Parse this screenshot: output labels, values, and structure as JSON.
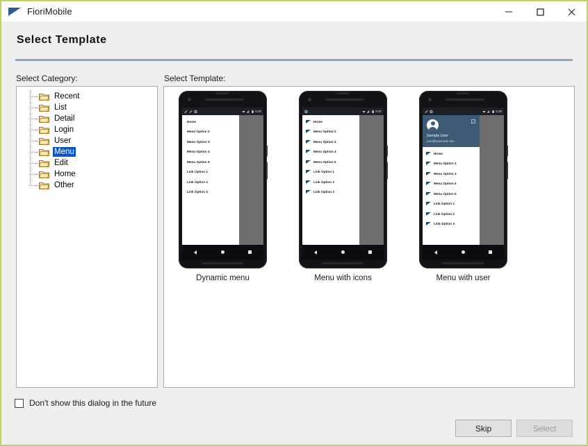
{
  "window": {
    "title": "FioriMobile",
    "icon": "flag-icon",
    "controls": [
      {
        "name": "minimize-button",
        "glyph": "minimize-icon"
      },
      {
        "name": "maximize-button",
        "glyph": "maximize-icon"
      },
      {
        "name": "close-button",
        "glyph": "close-icon"
      }
    ],
    "border_color": "#bdd460"
  },
  "header": {
    "title": "Select Template",
    "rule_color": "#8ba5c4"
  },
  "labels": {
    "category": "Select Category:",
    "template": "Select Template:"
  },
  "category_tree": {
    "selected": "Menu",
    "selection_color": "#0a57c1",
    "items": [
      {
        "label": "Recent"
      },
      {
        "label": "List"
      },
      {
        "label": "Detail"
      },
      {
        "label": "Login"
      },
      {
        "label": "User"
      },
      {
        "label": "Menu"
      },
      {
        "label": "Edit"
      },
      {
        "label": "Home"
      },
      {
        "label": "Other"
      }
    ]
  },
  "templates": [
    {
      "caption": "Dynamic menu",
      "variant": "plain",
      "status_time": "6:30",
      "status_left_icons": [
        "pencil-icon",
        "pencil-icon",
        "gear-icon"
      ],
      "menu_items": [
        "Home",
        "Menu Option 2",
        "Menu Option 3",
        "Menu Option 4",
        "Menu Option 5",
        "Link Option 1",
        "Link Option 2",
        "Link Option 3"
      ]
    },
    {
      "caption": "Menu with icons",
      "variant": "icons",
      "status_time": "6:31",
      "status_left_icons": [
        "gear-icon"
      ],
      "menu_items": [
        "Home",
        "Menu Option 2",
        "Menu Option 3",
        "Menu Option 4",
        "Menu Option 5",
        "Link Option 1",
        "Link Option 2",
        "Link Option 3"
      ]
    },
    {
      "caption": "Menu with user",
      "variant": "user",
      "status_time": "6:30",
      "status_left_icons": [
        "pencil-icon",
        "gear-icon"
      ],
      "user": {
        "name": "Sample User",
        "email": "user@somemail.com",
        "header_color": "#3d5a77"
      },
      "menu_items": [
        "Home",
        "Menu Option 2",
        "Menu Option 3",
        "Menu Option 4",
        "Menu Option 5",
        "Link Option 1",
        "Link Option 2",
        "Link Option 3"
      ]
    }
  ],
  "footer": {
    "checkbox_label": "Don't show this dialog in the future",
    "checkbox_checked": false,
    "skip_label": "Skip",
    "select_label": "Select",
    "select_disabled": true
  }
}
